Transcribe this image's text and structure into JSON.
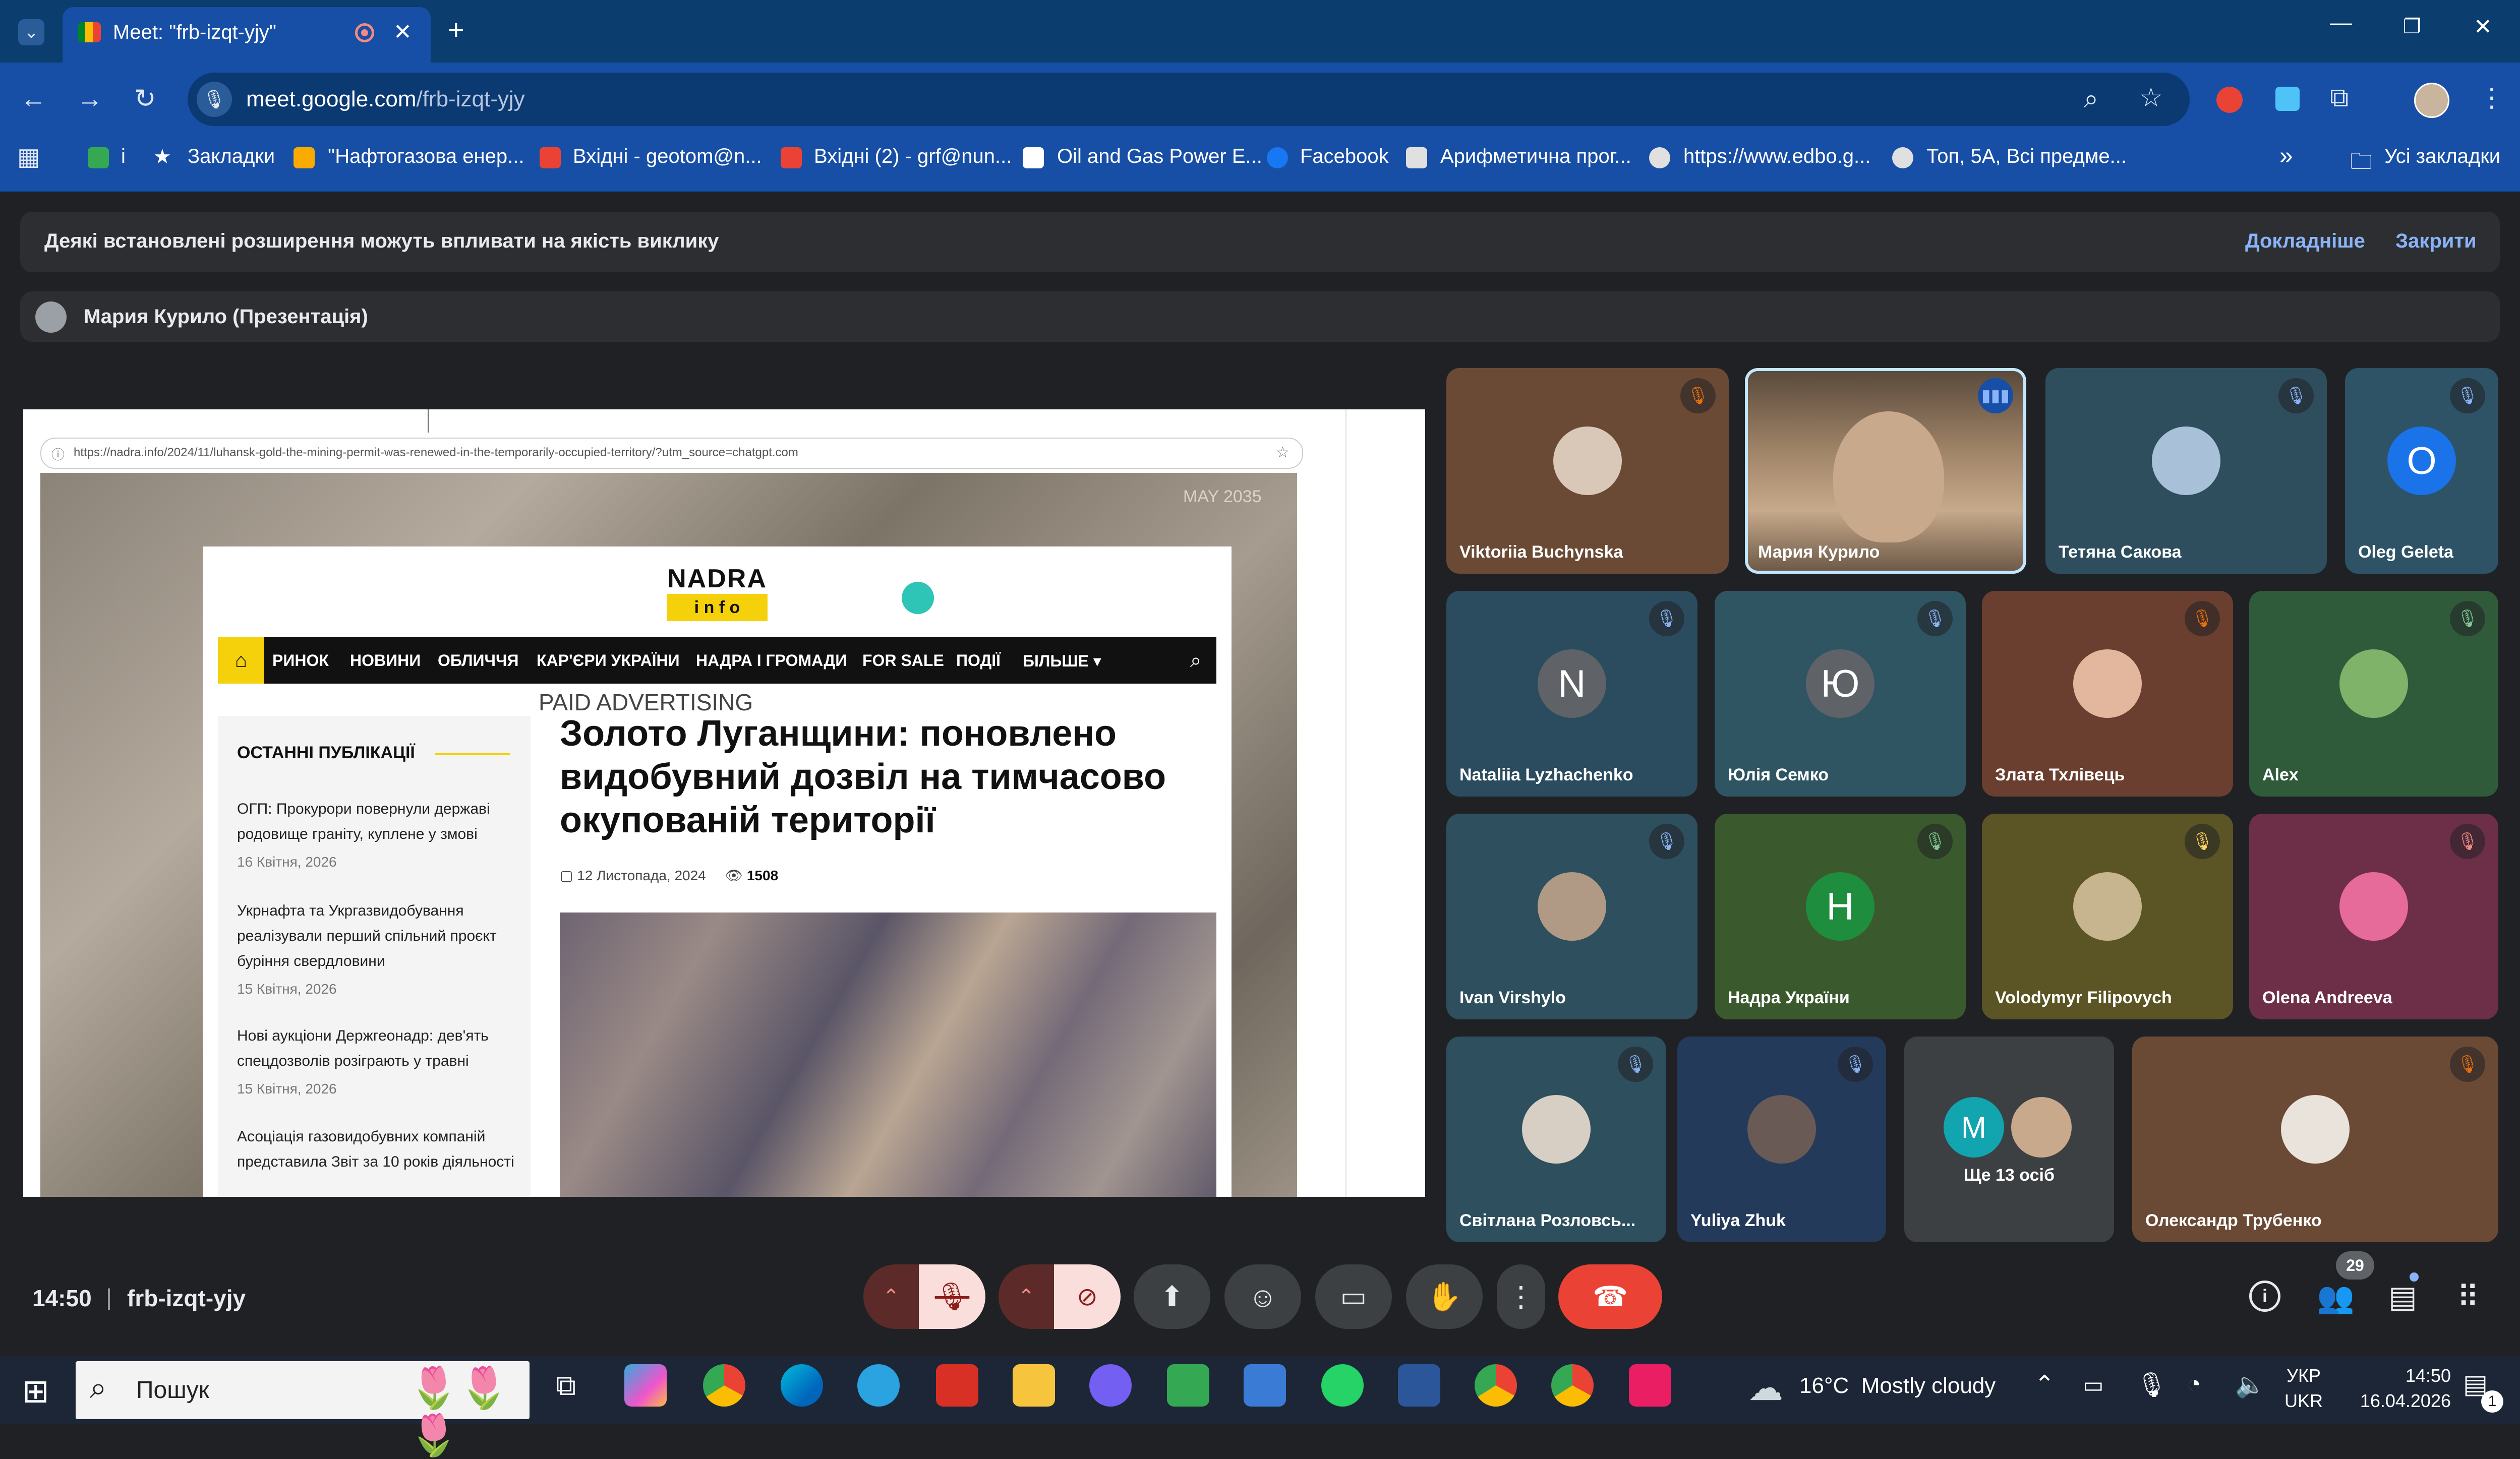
{
  "browser": {
    "tab_title": "Meet: \"frb-izqt-yjy\"",
    "new_tab": "+",
    "url_host": "meet.google.com",
    "url_path": "/frb-izqt-yjy",
    "bookmarks": [
      {
        "label": "i",
        "color": "#34a853"
      },
      {
        "label": "Закладки",
        "color": "#ffffff"
      },
      {
        "label": "\"Нафтогазова енер...",
        "color": "#f9ab00"
      },
      {
        "label": "Вхідні - geotom@n...",
        "color": "#ea4335"
      },
      {
        "label": "Вхідні (2) - grf@nun...",
        "color": "#ea4335"
      },
      {
        "label": "Oil and Gas Power E...",
        "color": "#ffffff"
      },
      {
        "label": "Facebook",
        "color": "#1877f2"
      },
      {
        "label": "Арифметична прог...",
        "color": "#ffffff"
      },
      {
        "label": "https://www.edbo.g...",
        "color": "#ffffff"
      },
      {
        "label": "Топ, 5А, Всі предме...",
        "color": "#ffffff"
      }
    ],
    "all_bookmarks": "Усі закладки",
    "more": "»"
  },
  "meet": {
    "warning_text": "Деякі встановлені розширення можуть впливати на якість виклику",
    "learn_more": "Докладніше",
    "close": "Закрити",
    "presenter_label": "Мария Курило (Презентація)",
    "time": "14:50",
    "separator": "|",
    "meeting_code": "frb-izqt-yjy",
    "people_count": "29"
  },
  "presentation": {
    "url": "https://nadra.info/2024/11/luhansk-gold-the-mining-permit-was-renewed-in-the-temporarily-occupied-territory/?utm_source=chatgpt.com",
    "corner_text": "MAY 2035",
    "logo_top": "NADRA",
    "logo_bottom": "i n f o",
    "nav": [
      "РИНОК",
      "НОВИНИ",
      "ОБЛИЧЧЯ",
      "КАР'ЄРИ УКРАЇНИ",
      "НАДРА І ГРОМАДИ",
      "FOR SALE",
      "ПОДІЇ",
      "БІЛЬШЕ ▾"
    ],
    "paid": "PAID ADVERTISING",
    "sidebar_title": "ОСТАННІ ПУБЛІКАЦІЇ",
    "posts": [
      {
        "title": "ОГП: Прокурори повернули державі родовище граніту, куплене у змові",
        "date": "16 Квітня, 2026"
      },
      {
        "title": "Укрнафта та Укргазвидобування реалізували перший спільний проєкт буріння свердловини",
        "date": "15 Квітня, 2026"
      },
      {
        "title": "Нові аукціони Держгеонадр: дев'ять спецдозволів розіграють у травні",
        "date": "15 Квітня, 2026"
      },
      {
        "title": "Асоціація газовидобувних компаній представила Звіт за 10 років діяльності",
        "date": ""
      }
    ],
    "headline": "Золото Луганщини: поновлено видобувний дозвіл на тимчасово окупованій території",
    "article_date": "12 Листопада, 2024",
    "views": "1508"
  },
  "participants": [
    {
      "name": "Viktoriia Buchynska",
      "bg": "#6b4a35",
      "initial": "",
      "avatar": "#d9c8b8",
      "mic": "#e8710a"
    },
    {
      "name": "Мария Курило",
      "bg": "#8a7560",
      "initial": "",
      "avatar": "#c9a98c",
      "mic": "#8ab4f8"
    },
    {
      "name": "Тетяна Сакова",
      "bg": "#2e4e5e",
      "initial": "",
      "avatar": "#a9c1d8",
      "mic": "#8ab4f8"
    },
    {
      "name": "Oleg Geleta",
      "bg": "#2e5266",
      "initial": "O",
      "avatar": "#1a73e8",
      "mic": "#8ab4f8"
    },
    {
      "name": "Nataliia Lyzhachenko",
      "bg": "#2b4c5e",
      "initial": "N",
      "avatar": "#5f6368",
      "mic": "#8ab4f8"
    },
    {
      "name": "Юлія Семко",
      "bg": "#2f5563",
      "initial": "Ю",
      "avatar": "#5f6368",
      "mic": "#8ab4f8"
    },
    {
      "name": "Злата Тхлівець",
      "bg": "#6a3f30",
      "initial": "",
      "avatar": "#e3b79d",
      "mic": "#e8710a"
    },
    {
      "name": "Alex",
      "bg": "#2f5b3b",
      "initial": "",
      "avatar": "#7fb36a",
      "mic": "#81c995"
    },
    {
      "name": "Ivan Virshylo",
      "bg": "#2e4f5d",
      "initial": "",
      "avatar": "#b09a86",
      "mic": "#8ab4f8"
    },
    {
      "name": "Надра України",
      "bg": "#3a5a2e",
      "initial": "H",
      "avatar": "#1e8e3e",
      "mic": "#81c995"
    },
    {
      "name": "Volodymyr Filipovych",
      "bg": "#5b5424",
      "initial": "",
      "avatar": "#c6b58e",
      "mic": "#fdd663"
    },
    {
      "name": "Olena Andreeva",
      "bg": "#6d2f47",
      "initial": "",
      "avatar": "#e66a9a",
      "mic": "#f28b82"
    },
    {
      "name": "Світлана Розловсь...",
      "bg": "#2e4f5d",
      "initial": "",
      "avatar": "#d8cfc4",
      "mic": "#8ab4f8"
    },
    {
      "name": "Yuliya Zhuk",
      "bg": "#243a5a",
      "initial": "",
      "avatar": "#6a5a55",
      "mic": "#8ab4f8"
    },
    {
      "name": "Ще 13 осіб",
      "bg": "#3c4043",
      "initial": "M",
      "avatar": "#12a4af",
      "mic": ""
    },
    {
      "name": "Олександр Трубенко",
      "bg": "#6b4a35",
      "initial": "",
      "avatar": "#e9e3dc",
      "mic": "#e8710a"
    }
  ],
  "taskbar": {
    "search_placeholder": "Пошук",
    "weather": "16°C  Mostly cloudy",
    "lang_top": "УКР",
    "lang_bottom": "UKR",
    "clock_time": "14:50",
    "clock_date": "16.04.2026",
    "notif_count": "1"
  }
}
